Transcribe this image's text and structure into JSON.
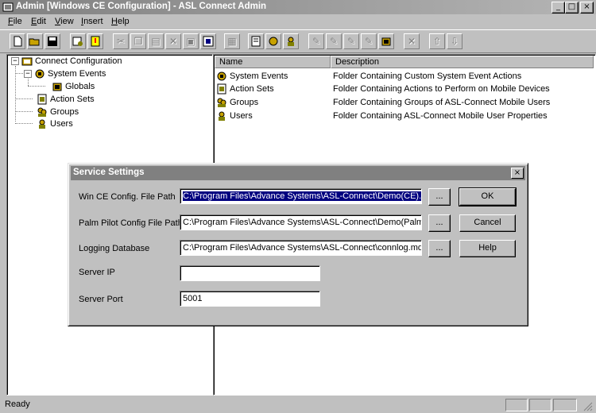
{
  "window": {
    "title": "Admin [Windows CE Configuration] - ASL Connect Admin",
    "min_glyph": "_",
    "max_glyph": "□",
    "close_glyph": "×"
  },
  "menubar": [
    {
      "label_ul": "F",
      "label_rest": "ile"
    },
    {
      "label_ul": "E",
      "label_rest": "dit"
    },
    {
      "label_ul": "V",
      "label_rest": "iew"
    },
    {
      "label_ul": "I",
      "label_rest": "nsert"
    },
    {
      "label_ul": "H",
      "label_rest": "elp"
    }
  ],
  "tree": {
    "root": "Connect Configuration",
    "system_events": "System Events",
    "globals": "Globals",
    "action_sets": "Action Sets",
    "groups": "Groups",
    "users": "Users",
    "expander_minus": "−"
  },
  "list": {
    "columns": [
      "Name",
      "Description"
    ],
    "rows": [
      {
        "name": "System Events",
        "description": "Folder Containing Custom System Event Actions"
      },
      {
        "name": "Action Sets",
        "description": "Folder Containing Actions to Perform on Mobile Devices"
      },
      {
        "name": "Groups",
        "description": "Folder Containing Groups of ASL-Connect Mobile Users"
      },
      {
        "name": "Users",
        "description": "Folder Containing ASL-Connect Mobile User Properties"
      }
    ]
  },
  "dialog": {
    "title": "Service Settings",
    "close_glyph": "×",
    "fields": {
      "wince_label": "Win CE Config. File Path",
      "wince_value": "C:\\Program Files\\Advance Systems\\ASL-Connect\\Demo(CE).acf",
      "palm_label": "Palm Pilot Config File Path",
      "palm_value": "C:\\Program Files\\Advance Systems\\ASL-Connect\\Demo(Palm).a",
      "logdb_label": "Logging Database",
      "logdb_value": "C:\\Program Files\\Advance Systems\\ASL-Connect\\connlog.mdb",
      "serverip_label": "Server IP",
      "serverip_value": "",
      "serverport_label": "Server Port",
      "serverport_value": "5001"
    },
    "browse_label": "...",
    "ok_label": "OK",
    "cancel_label": "Cancel",
    "help_label": "Help"
  },
  "status": {
    "text": "Ready"
  },
  "colors": {
    "selection": "#000080",
    "face": "#c0c0c0",
    "title_inactive": "#808080"
  }
}
